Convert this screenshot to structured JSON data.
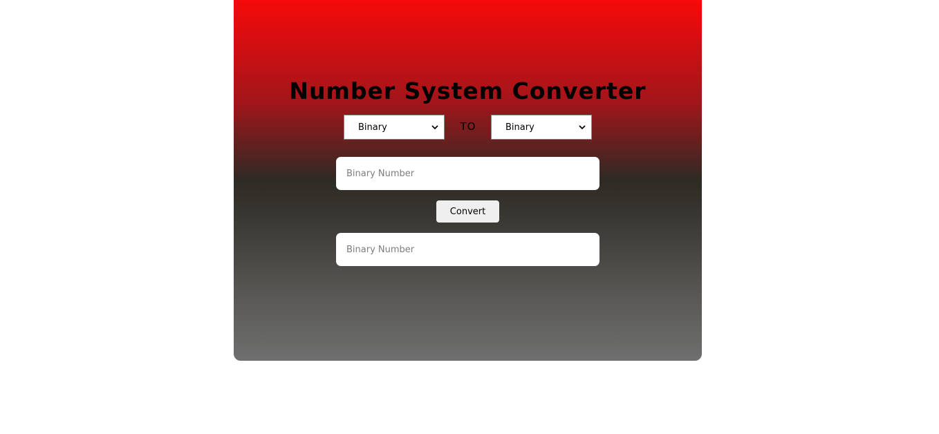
{
  "app": {
    "title": "Number System Converter"
  },
  "converter": {
    "from_select": {
      "value": "Binary"
    },
    "to_label": "TO",
    "to_select": {
      "value": "Binary"
    },
    "input": {
      "placeholder": "Binary Number"
    },
    "convert_label": "Convert",
    "output": {
      "placeholder": "Binary Number"
    }
  },
  "colors": {
    "gradient_top": "#f60a0a",
    "gradient_mid": "#2e2a24",
    "gradient_bottom": "#6f6f6f",
    "field_bg": "#ffffff",
    "button_bg": "#efefef"
  }
}
